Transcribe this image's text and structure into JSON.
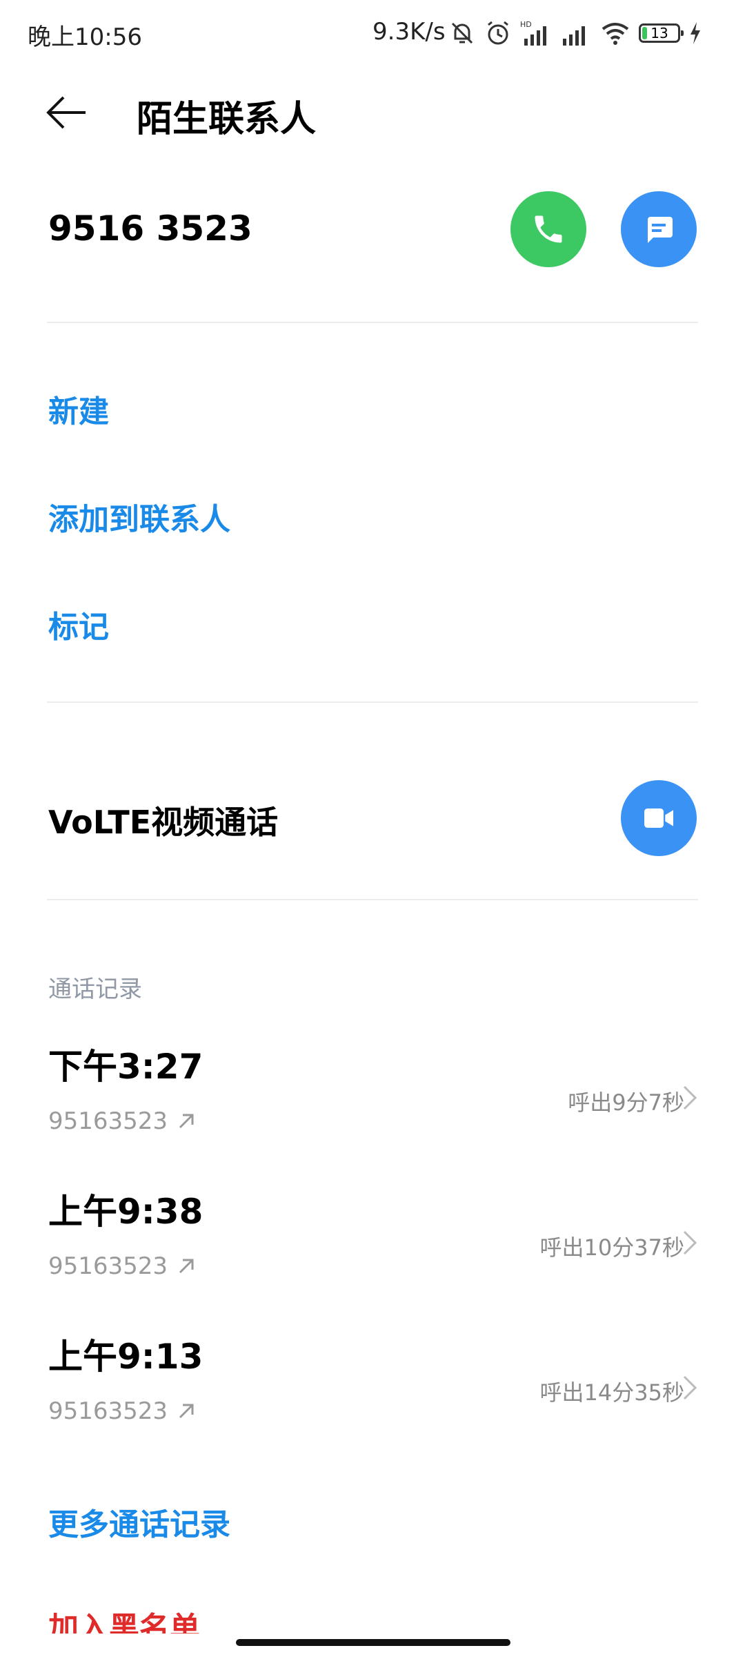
{
  "status_bar": {
    "time": "晚上10:56",
    "net_speed": "9.3K/s",
    "hd_label": "HD",
    "battery_level": "13",
    "icons": [
      "mute-bell-icon",
      "alarm-icon",
      "signal-hd-icon",
      "signal-icon",
      "wifi-icon",
      "battery-icon",
      "charging-icon"
    ]
  },
  "header": {
    "title": "陌生联系人"
  },
  "contact": {
    "number": "9516 3523"
  },
  "actions": {
    "new": "新建",
    "add_to_contacts": "添加到联系人",
    "mark": "标记"
  },
  "volte": {
    "label": "VoLTE视频通话"
  },
  "call_log": {
    "section_title": "通话记录",
    "entries": [
      {
        "time": "下午3:27",
        "number": "95163523",
        "detail": "呼出9分7秒"
      },
      {
        "time": "上午9:38",
        "number": "95163523",
        "detail": "呼出10分37秒"
      },
      {
        "time": "上午9:13",
        "number": "95163523",
        "detail": "呼出14分35秒"
      }
    ],
    "more": "更多通话记录"
  },
  "blacklist": {
    "label": "加入黑名单"
  },
  "colors": {
    "accent": "#1a8ae8",
    "call_green": "#3cc862",
    "button_blue": "#3a93f4",
    "danger": "#e02b2b"
  }
}
